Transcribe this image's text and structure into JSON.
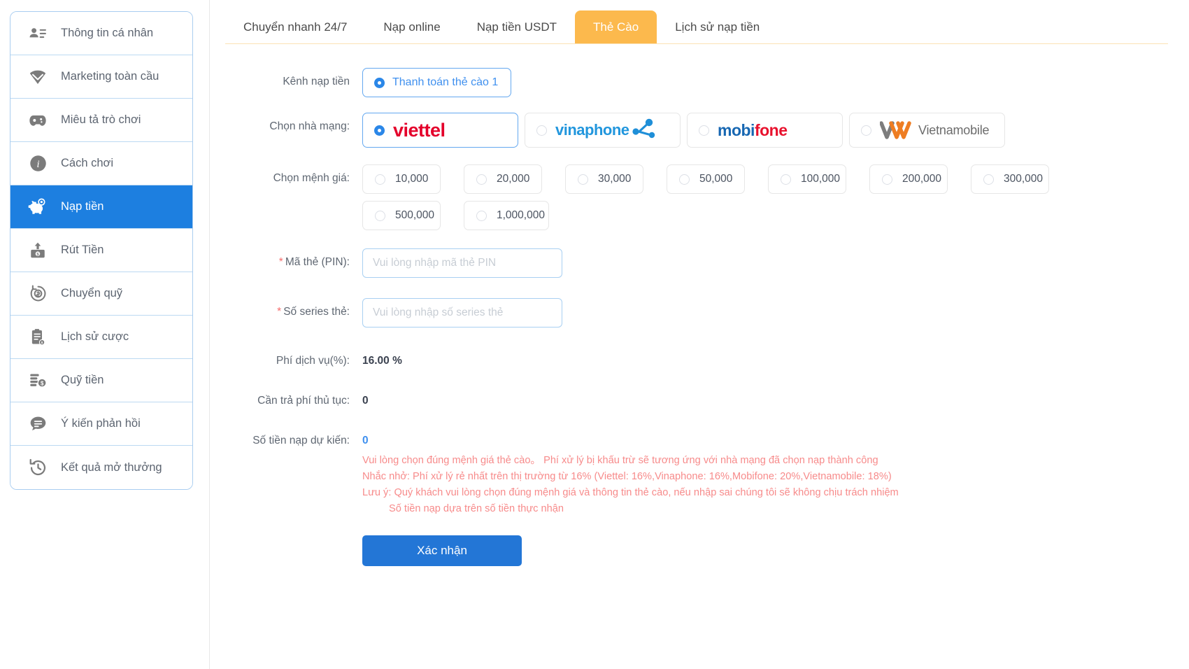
{
  "sidebar": {
    "items": [
      {
        "label": "Thông tin cá nhân",
        "icon": "user-card-icon",
        "active": false
      },
      {
        "label": "Marketing toàn cầu",
        "icon": "diamond-icon",
        "active": false
      },
      {
        "label": "Miêu tả trò chơi",
        "icon": "gamepad-icon",
        "active": false
      },
      {
        "label": "Cách chơi",
        "icon": "info-circle-icon",
        "active": false
      },
      {
        "label": "Nạp tiền",
        "icon": "piggy-bank-icon",
        "active": true
      },
      {
        "label": "Rút Tiền",
        "icon": "withdraw-icon",
        "active": false
      },
      {
        "label": "Chuyển quỹ",
        "icon": "transfer-funds-icon",
        "active": false
      },
      {
        "label": "Lịch sử cược",
        "icon": "clipboard-icon",
        "active": false
      },
      {
        "label": "Quỹ tiền",
        "icon": "coins-icon",
        "active": false
      },
      {
        "label": "Ý kiến phản hồi",
        "icon": "comment-icon",
        "active": false
      },
      {
        "label": "Kết quả mở thưởng",
        "icon": "history-clock-icon",
        "active": false
      }
    ]
  },
  "tabs": [
    {
      "label": "Chuyển nhanh 24/7",
      "active": false
    },
    {
      "label": "Nạp online",
      "active": false
    },
    {
      "label": "Nạp tiền USDT",
      "active": false
    },
    {
      "label": "Thẻ Cào",
      "active": true
    },
    {
      "label": "Lịch sử nạp tiền",
      "active": false
    }
  ],
  "form": {
    "channel": {
      "label": "Kênh nạp tiền",
      "option": "Thanh toán thẻ cào 1",
      "selected": true
    },
    "carrier": {
      "label": "Chọn nhà mạng:",
      "options": [
        {
          "name": "viettel",
          "selected": true
        },
        {
          "name": "vinaphone",
          "selected": false
        },
        {
          "name": "mobifone",
          "selected": false
        },
        {
          "name": "Vietnamobile",
          "selected": false
        }
      ]
    },
    "denomination": {
      "label": "Chọn mệnh giá:",
      "options": [
        {
          "value": "10,000",
          "selected": false
        },
        {
          "value": "20,000",
          "selected": false
        },
        {
          "value": "30,000",
          "selected": false
        },
        {
          "value": "50,000",
          "selected": false
        },
        {
          "value": "100,000",
          "selected": false
        },
        {
          "value": "200,000",
          "selected": false
        },
        {
          "value": "300,000",
          "selected": false
        },
        {
          "value": "500,000",
          "selected": false
        },
        {
          "value": "1,000,000",
          "selected": false
        }
      ]
    },
    "pin": {
      "label": "Mã thẻ (PIN):",
      "required": true,
      "value": "",
      "placeholder": "Vui lòng nhập mã thẻ PIN"
    },
    "serial": {
      "label": "Số series thẻ:",
      "required": true,
      "value": "",
      "placeholder": "Vui lòng nhập số series thẻ"
    },
    "service_fee": {
      "label": "Phí dịch vụ(%):",
      "value": "16.00 %"
    },
    "handling_fee": {
      "label": "Cần trả phí thủ tục:",
      "value": "0"
    },
    "expected_amount": {
      "label": "Số tiền nạp dự kiến:",
      "value": "0"
    },
    "notes": [
      "Vui lòng chọn đúng mệnh giá thẻ cào。 Phí xử lý bị khấu trừ sẽ tương ứng với nhà mạng đã chọn nạp thành công",
      "Nhắc nhở: Phí xử lý rẻ nhất trên thị trường từ 16% (Viettel: 16%,Vinaphone: 16%,Mobifone: 20%,Vietnamobile: 18%)",
      "Lưu ý: Quý khách vui lòng chọn đúng mệnh giá và thông tin thẻ cào, nếu nhập sai chúng tôi sẽ không chịu trách nhiệm",
      "Số tiền nạp dựa trên số tiền thực nhận"
    ],
    "submit_label": "Xác nhận"
  },
  "colors": {
    "accent_blue": "#2376d6",
    "tab_active": "#fcb94d",
    "sidebar_active": "#1d7fe0",
    "note_red": "#f78b8b",
    "viettel_red": "#e4002b",
    "vinaphone_blue": "#2196dd",
    "mobifone_blue": "#1767b2",
    "mobifone_red": "#e8112d",
    "vietnamobile_orange": "#ee7d22",
    "vietnamobile_gray": "#6c6c6c"
  }
}
